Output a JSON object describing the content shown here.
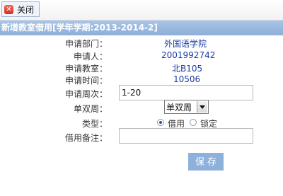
{
  "toolbar": {
    "close_label": "关闭"
  },
  "form": {
    "title": "新增教室借用[学年学期:2013-2014-2]",
    "department": {
      "label": "申请部门：",
      "value": "外国语学院"
    },
    "applicant": {
      "label": "申请人：",
      "value": "2001992742"
    },
    "classroom": {
      "label": "申请教室：",
      "value": "北B105"
    },
    "time": {
      "label": "申请时间：",
      "value": "10506"
    },
    "weeks": {
      "label": "申请周次：",
      "value": "1-20"
    },
    "week_parity": {
      "label": "单双周：",
      "selected": "单双周"
    },
    "type": {
      "label": "类型：",
      "options": [
        "借用",
        "锁定"
      ],
      "selected": "借用"
    },
    "remark": {
      "label": "借用备注：",
      "value": ""
    },
    "save_label": "保存"
  }
}
